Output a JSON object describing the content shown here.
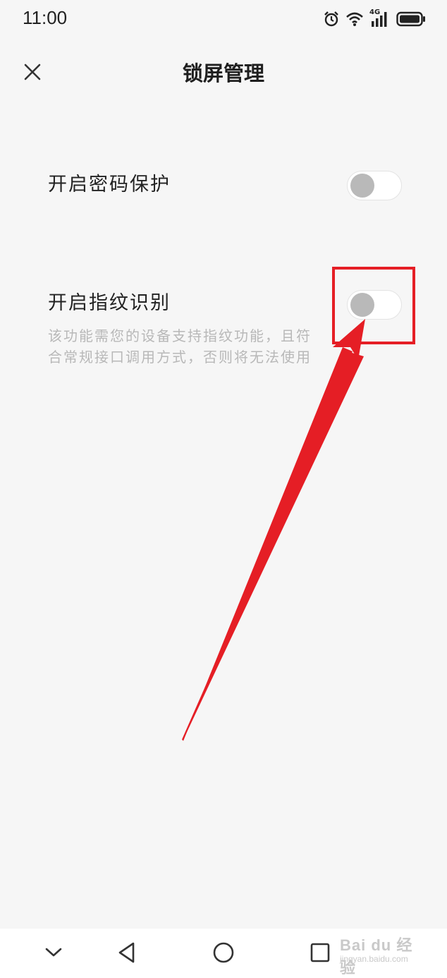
{
  "status_bar": {
    "time": "11:00",
    "icons": [
      "alarm-icon",
      "wifi-icon",
      "signal-4g-icon",
      "battery-icon"
    ],
    "network_label": "4G"
  },
  "header": {
    "title": "锁屏管理",
    "close_icon": "close-icon"
  },
  "settings": {
    "password_protection": {
      "label": "开启密码保护",
      "enabled": false
    },
    "fingerprint": {
      "label": "开启指纹识别",
      "enabled": false,
      "description_line1": "该功能需您的设备支持指纹功能，且符",
      "description_line2": "合常规接口调用方式，否则将无法使用"
    }
  },
  "annotation": {
    "color": "#e51e25"
  },
  "nav_bar": {
    "buttons": [
      "chevron-down-icon",
      "back-icon",
      "home-icon",
      "recents-icon"
    ]
  },
  "watermark": {
    "text": "Bai du 经验",
    "sub": "jingyan.baidu.com"
  },
  "colors": {
    "background": "#f6f6f6",
    "toggle_off_knob": "#b9b9b9",
    "description_text": "#b8b8b8",
    "accent_red": "#e51e25"
  }
}
